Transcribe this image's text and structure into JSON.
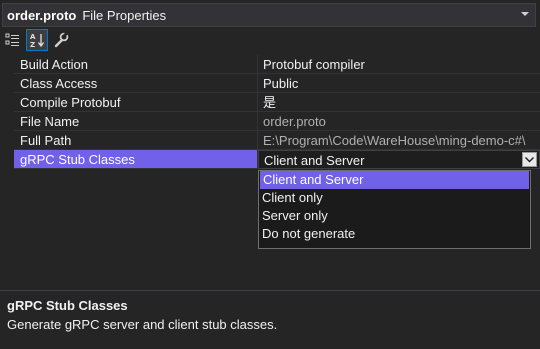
{
  "header": {
    "object_name": "order.proto",
    "object_type": "File Properties"
  },
  "toolbar": {
    "buttons": [
      {
        "icon": "categorized-icon"
      },
      {
        "icon": "alphabetical-sort-icon",
        "active": true
      },
      {
        "icon": "property-pages-wrench-icon"
      }
    ]
  },
  "properties": [
    {
      "name": "Build Action",
      "value": "Protobuf compiler"
    },
    {
      "name": "Class Access",
      "value": "Public"
    },
    {
      "name": "Compile Protobuf",
      "value": "是"
    },
    {
      "name": "File Name",
      "value": "order.proto"
    },
    {
      "name": "Full Path",
      "value": "E:\\Program\\Code\\WareHouse\\ming-demo-c#\\"
    },
    {
      "name": "gRPC Stub Classes",
      "value": "Client and Server"
    }
  ],
  "dropdown": {
    "options": [
      "Client and Server",
      "Client only",
      "Server only",
      "Do not generate"
    ],
    "selected_index": 0
  },
  "description": {
    "title": "gRPC Stub Classes",
    "text": "Generate gRPC server and client stub classes."
  },
  "colors": {
    "background": "#252526",
    "selection": "#7160e8",
    "accent": "#007acc"
  }
}
